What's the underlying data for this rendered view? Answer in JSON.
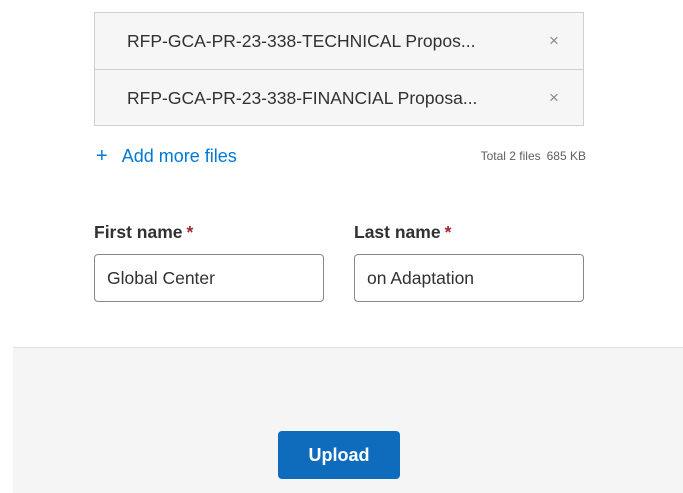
{
  "files": {
    "items": [
      {
        "name": "RFP-GCA-PR-23-338-TECHNICAL Propos...",
        "remove_glyph": "×"
      },
      {
        "name": "RFP-GCA-PR-23-338-FINANCIAL Proposa...",
        "remove_glyph": "×"
      }
    ],
    "add_more": {
      "icon_glyph": "+",
      "label": "Add more files"
    },
    "total_label": "Total 2 files",
    "total_size": "685 KB"
  },
  "form": {
    "first_name": {
      "label": "First name",
      "required_mark": "*",
      "value": "Global Center"
    },
    "last_name": {
      "label": "Last name",
      "required_mark": "*",
      "value": "on Adaptation"
    }
  },
  "footer": {
    "upload_label": "Upload"
  },
  "colors": {
    "accent": "#0f6cbd",
    "link": "#0078d4",
    "required": "#a4262c"
  }
}
